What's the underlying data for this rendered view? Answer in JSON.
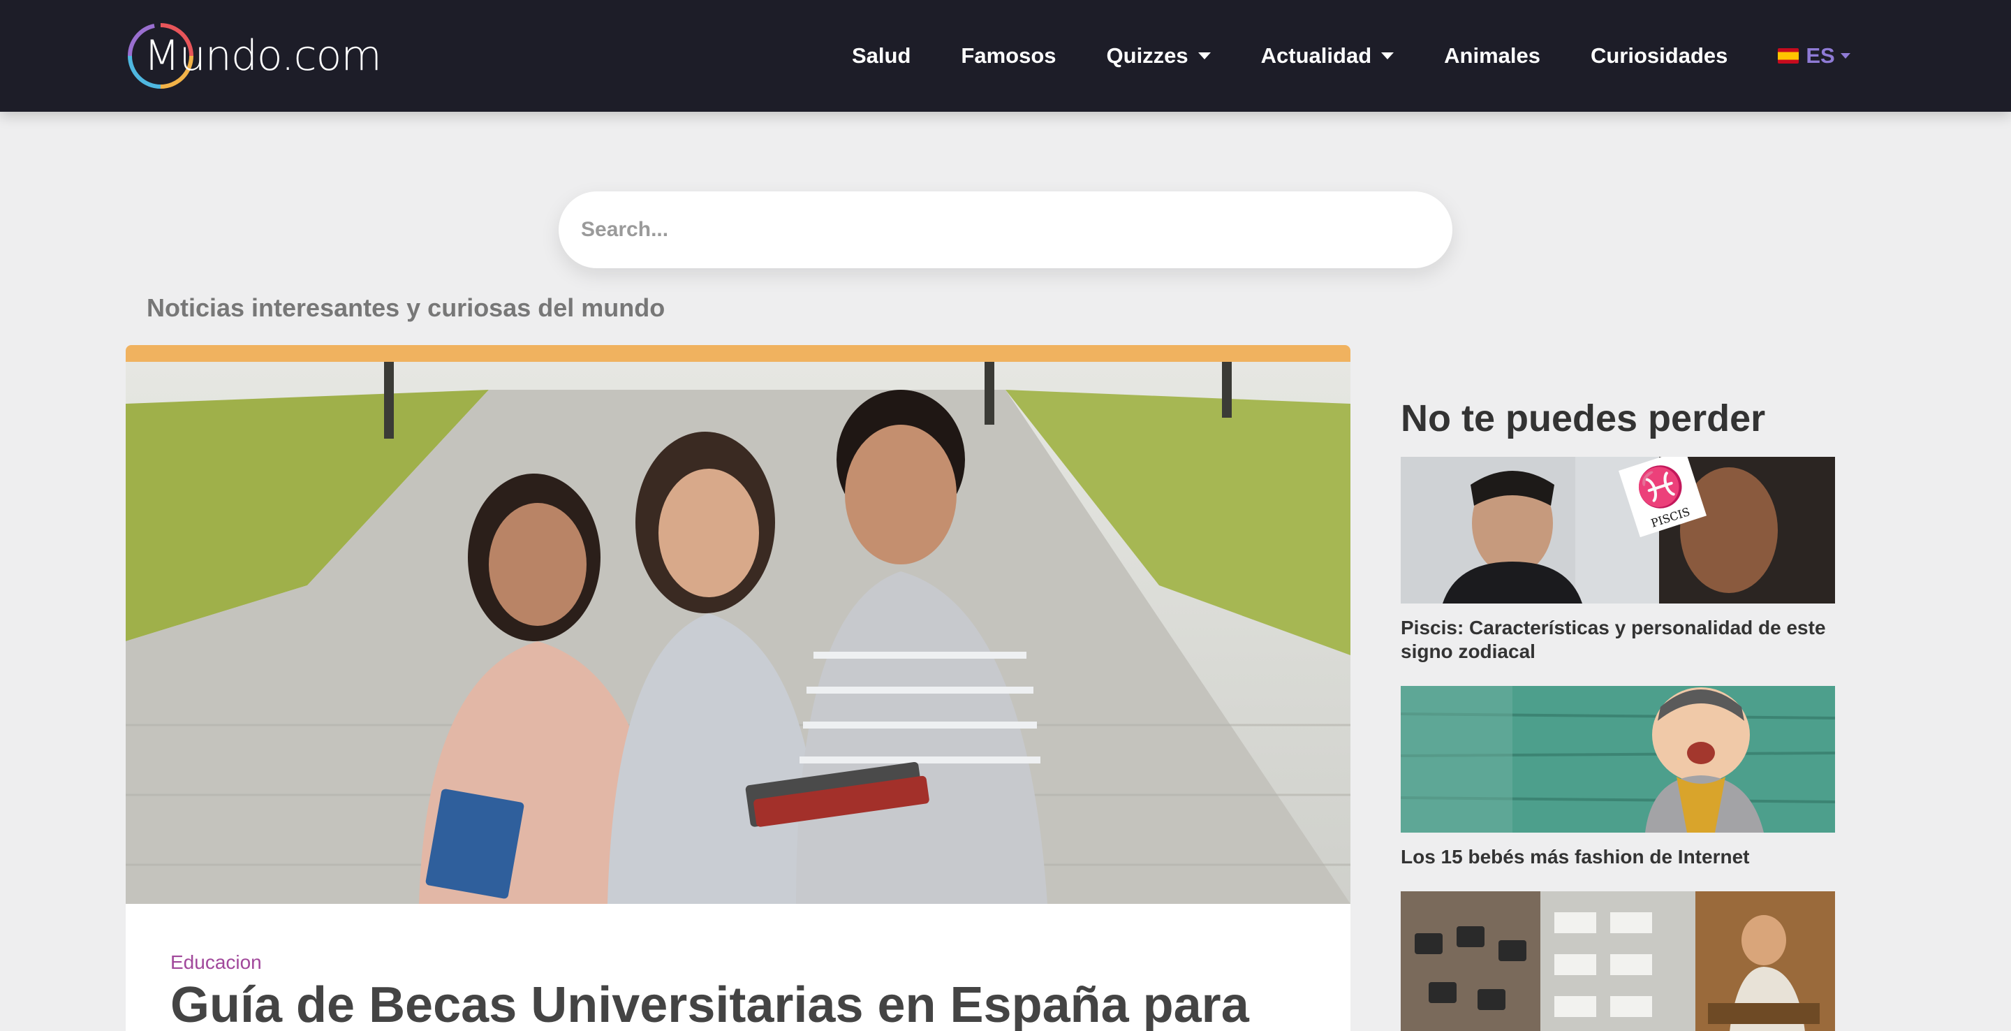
{
  "header": {
    "logo_text": "Mundo.com",
    "nav": [
      {
        "label": "Salud",
        "dropdown": false
      },
      {
        "label": "Famosos",
        "dropdown": false
      },
      {
        "label": "Quizzes",
        "dropdown": true
      },
      {
        "label": "Actualidad",
        "dropdown": true
      },
      {
        "label": "Animales",
        "dropdown": false
      },
      {
        "label": "Curiosidades",
        "dropdown": false
      }
    ],
    "language": "ES"
  },
  "search": {
    "placeholder": "Search..."
  },
  "tagline": "Noticias interesantes y curiosas del mundo",
  "featured": {
    "category": "Educacion",
    "title": "Guía de Becas Universitarias en España para",
    "accent_color": "#f0b25f"
  },
  "sidebar": {
    "title": "No te puedes perder",
    "items": [
      {
        "caption": "Piscis: Características y personalidad de este signo zodiacal",
        "badge": "PISCIS"
      },
      {
        "caption": "Los 15 bebés más fashion de Internet"
      },
      {
        "caption": ""
      }
    ]
  },
  "colors": {
    "navbar": "#1d1d28",
    "category": "#a1489b",
    "language": "#8f7bd6"
  }
}
